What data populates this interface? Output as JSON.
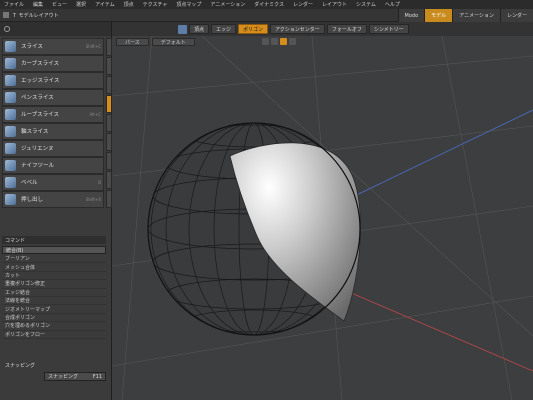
{
  "menu": [
    "ファイル",
    "編集",
    "ビュー",
    "選択",
    "アイテム",
    "頂点",
    "テクスチャ",
    "頂点マップ",
    "アニメーション",
    "ダイナミクス",
    "レンダー",
    "レイアウト",
    "システム",
    "ヘルプ"
  ],
  "window_title": "Ｔ モデルレイアウト",
  "mode_tabs": [
    "Modo",
    "モデル",
    "アニメーション",
    "レンダー"
  ],
  "mode_active_index": 1,
  "subbar": {
    "vertex": "頂点",
    "edge": "エッジ",
    "polygon": "ポリゴン",
    "action_center": "アクションセンター",
    "falloff": "フォールオフ",
    "symmetry": "シンメトリー"
  },
  "tools": [
    {
      "label": "スライス",
      "shortcut": "Shift+C"
    },
    {
      "label": "カーブスライス",
      "shortcut": ""
    },
    {
      "label": "エッジスライス",
      "shortcut": ""
    },
    {
      "label": "ペンスライス",
      "shortcut": ""
    },
    {
      "label": "ループスライス",
      "shortcut": "Alt+C"
    },
    {
      "label": "軸スライス",
      "shortcut": ""
    },
    {
      "label": "ジュリエンヌ",
      "shortcut": ""
    },
    {
      "label": "ナイフツール",
      "shortcut": ""
    },
    {
      "label": "ベベル",
      "shortcut": "B"
    },
    {
      "label": "押し出し",
      "shortcut": "Shift+X"
    }
  ],
  "commands": {
    "header": "コマンド",
    "selected": "統合(B)",
    "items": [
      "ブーリアン",
      "メッシュ合体",
      "カット",
      "重複ポリゴン修正",
      "エッジ結合",
      "法線を統合",
      "ジオメトリーマップ",
      "合成ポリゴン",
      "穴を埋めるポリゴン",
      "ポリゴンをフロー"
    ]
  },
  "snapping": {
    "header": "スナッピング",
    "button": "スナッピング",
    "shortcut": "F11"
  },
  "viewport": {
    "tab1": "パース",
    "tab2": "デフォルト",
    "shading_icon": "wireframe-sphere"
  }
}
